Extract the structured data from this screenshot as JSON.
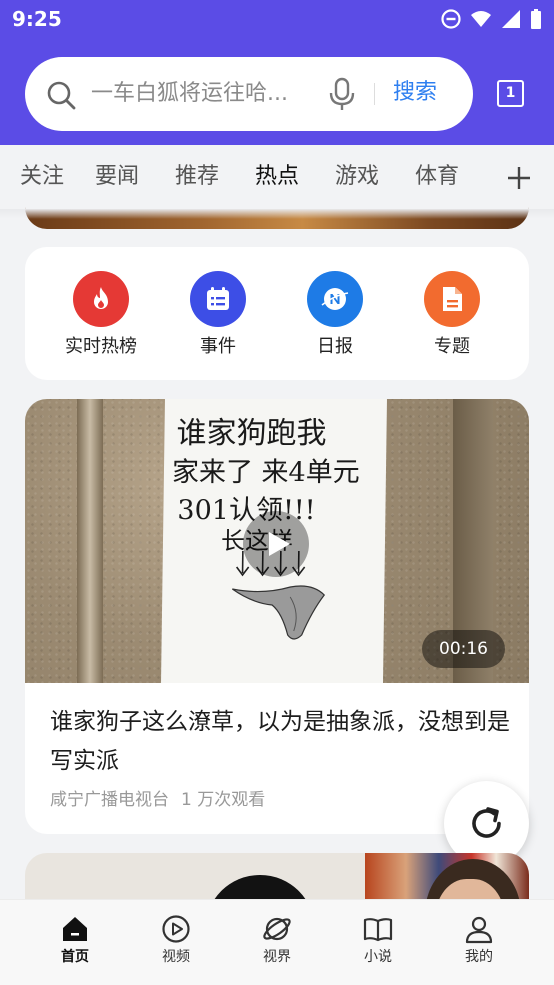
{
  "status_bar": {
    "time": "9:25",
    "icons": [
      "do-not-disturb-icon",
      "wifi-icon",
      "signal-icon",
      "battery-icon"
    ]
  },
  "colors": {
    "header_bg": "#5b4ce6",
    "search_button": "#2e7ff0",
    "hot_list": "#e53935",
    "events": "#3d4ee6",
    "daily": "#1e7be6",
    "topics": "#f26b2f"
  },
  "search": {
    "placeholder_text": "一车白狐将运往哈...",
    "button_label": "搜索",
    "tabs_count": "1"
  },
  "tabs": [
    {
      "label": "关注",
      "active": false
    },
    {
      "label": "要闻",
      "active": false
    },
    {
      "label": "推荐",
      "active": false
    },
    {
      "label": "热点",
      "active": true
    },
    {
      "label": "游戏",
      "active": false
    },
    {
      "label": "体育",
      "active": false
    }
  ],
  "quick_links": [
    {
      "label": "实时热榜",
      "icon": "flame-icon"
    },
    {
      "label": "事件",
      "icon": "calendar-list-icon"
    },
    {
      "label": "日报",
      "icon": "n-logo-icon"
    },
    {
      "label": "专题",
      "icon": "document-icon"
    }
  ],
  "video_card": {
    "duration": "00:16",
    "title": "谁家狗子这么潦草，以为是抽象派，没想到是写实派",
    "source": "咸宁广播电视台",
    "views": "1 万次观看",
    "note_lines": [
      "谁家狗跑我",
      "家来了 来4单元",
      "301认领!!!",
      "长这样"
    ]
  },
  "bottom_nav": [
    {
      "label": "首页",
      "icon": "home-icon",
      "active": true
    },
    {
      "label": "视频",
      "icon": "play-circle-icon",
      "active": false
    },
    {
      "label": "视界",
      "icon": "planet-icon",
      "active": false
    },
    {
      "label": "小说",
      "icon": "book-icon",
      "active": false
    },
    {
      "label": "我的",
      "icon": "person-icon",
      "active": false
    }
  ]
}
